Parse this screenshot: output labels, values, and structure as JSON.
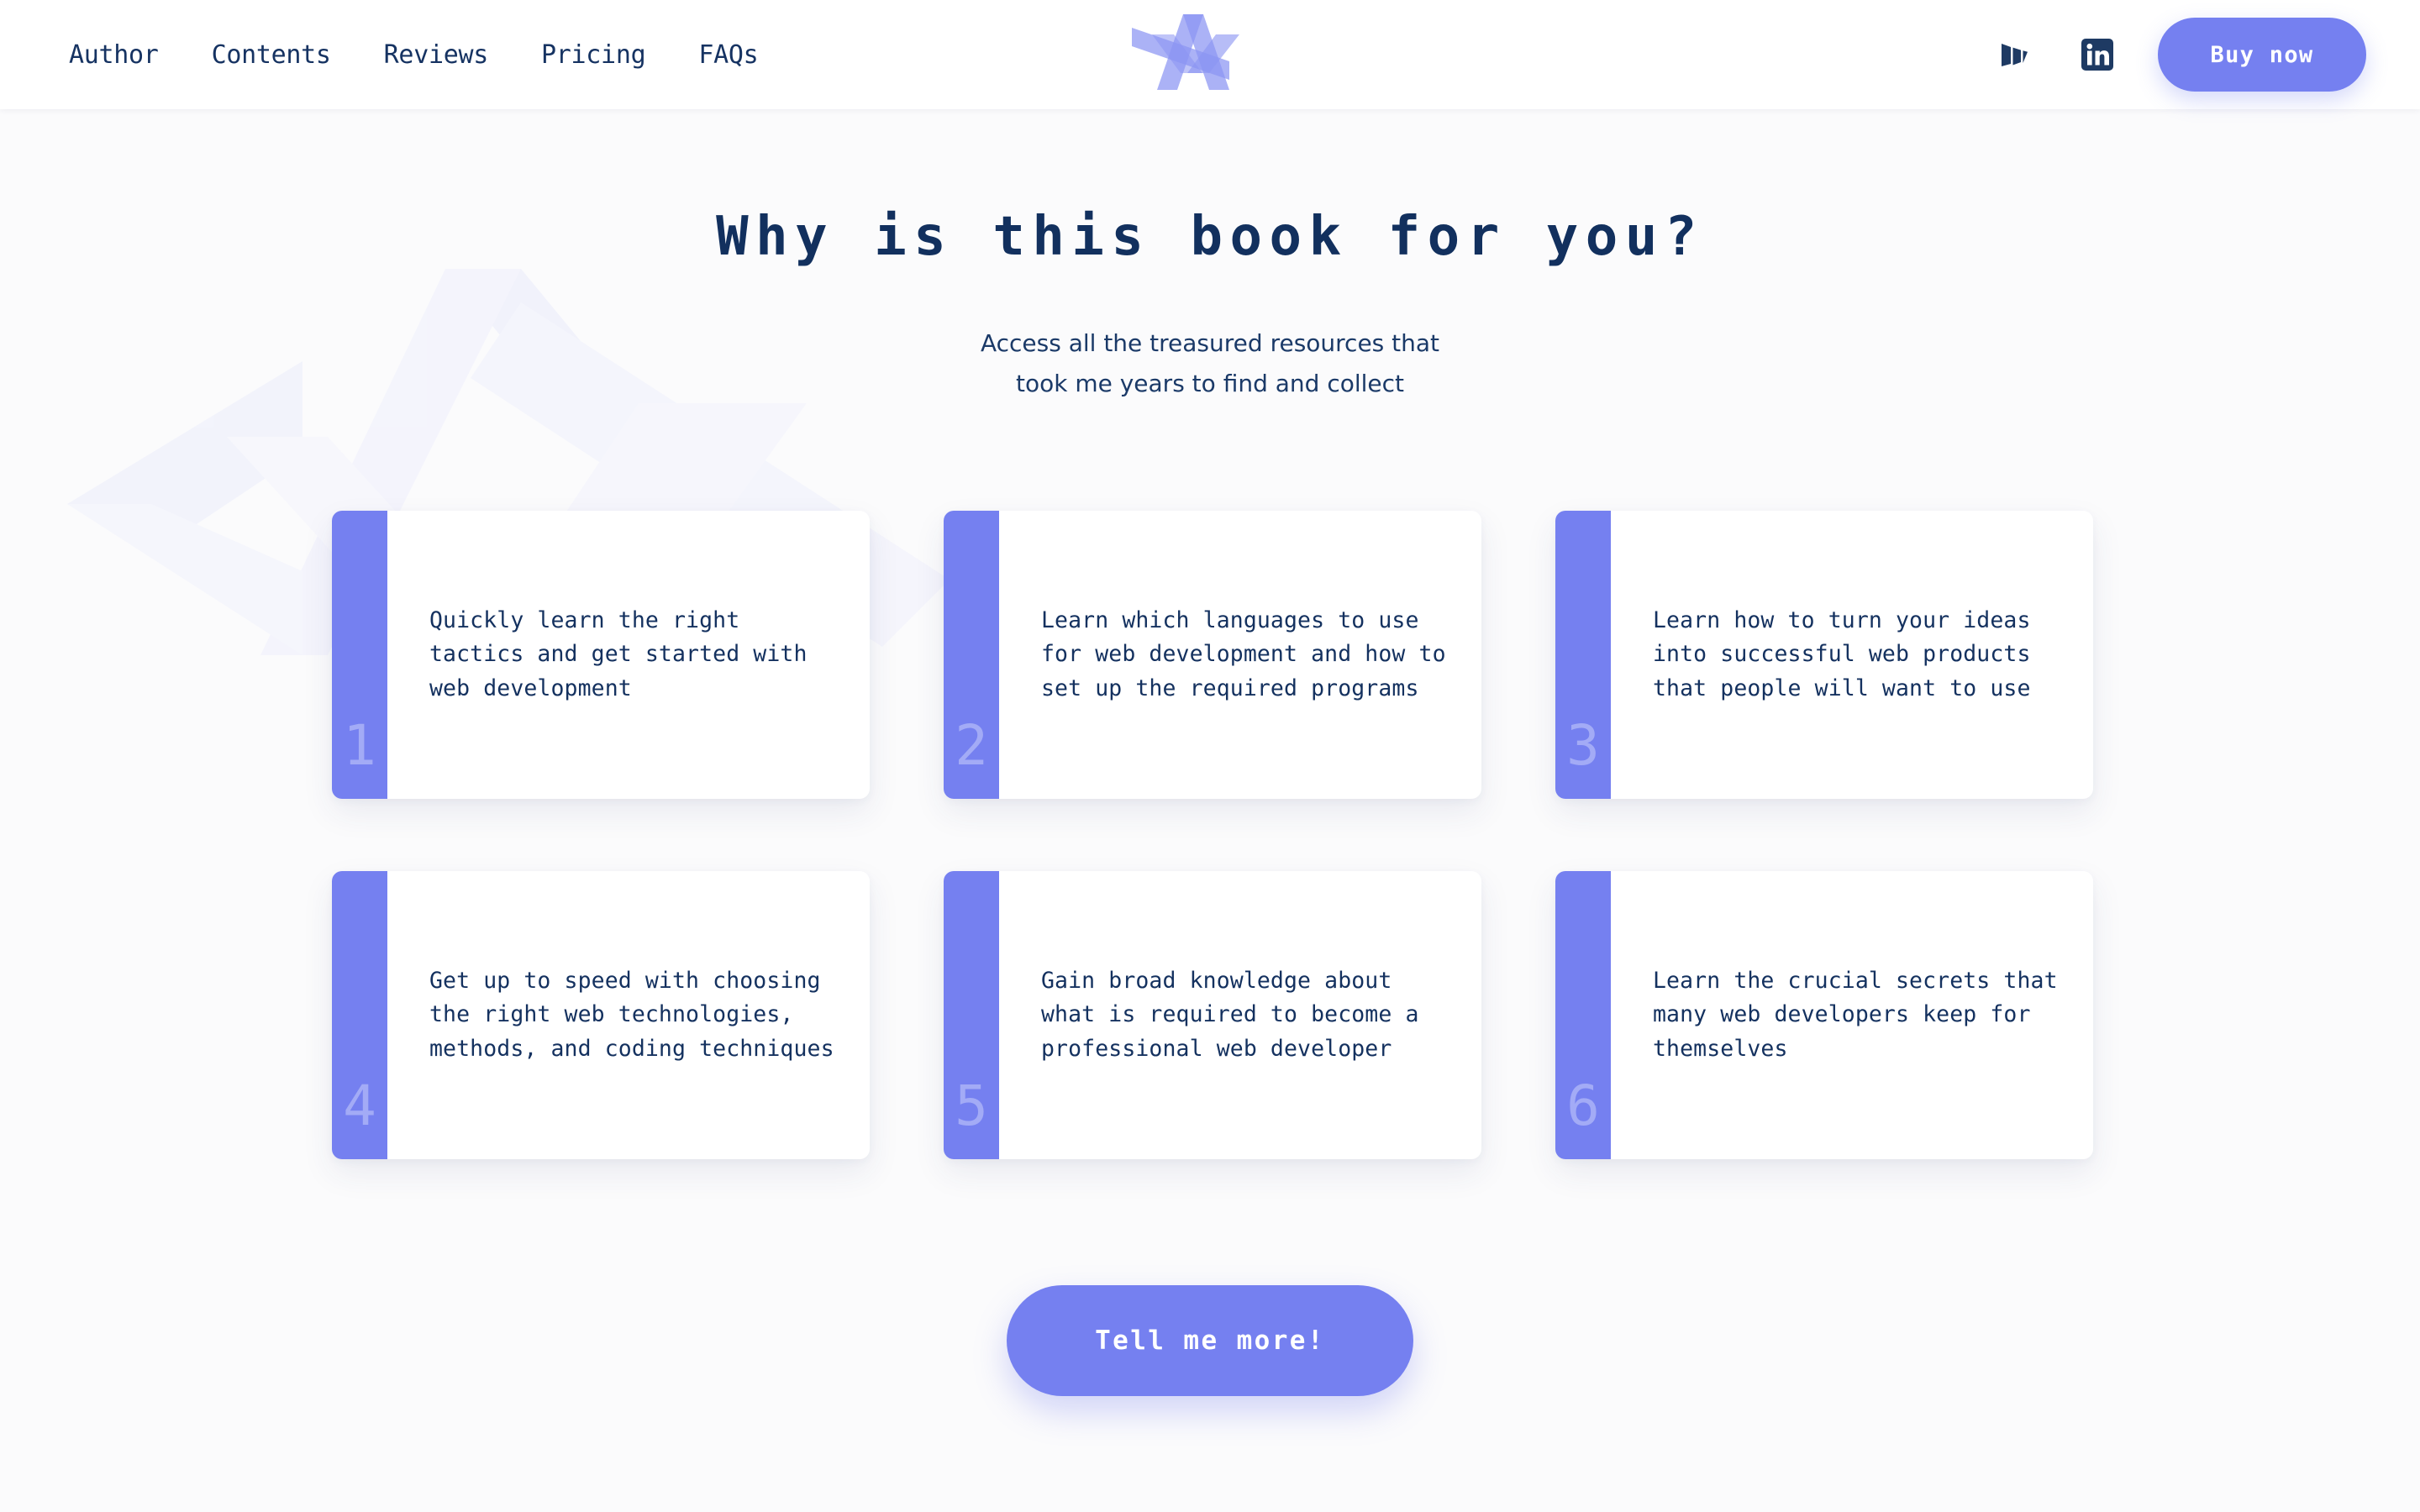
{
  "header": {
    "nav_items": [
      {
        "label": "Author"
      },
      {
        "label": "Contents"
      },
      {
        "label": "Reviews"
      },
      {
        "label": "Pricing"
      },
      {
        "label": "FAQs"
      }
    ],
    "logo_icon": "abstract-chevron-logo",
    "social": [
      {
        "icon": "medium-icon",
        "name": "Medium"
      },
      {
        "icon": "linkedin-icon",
        "name": "LinkedIn"
      }
    ],
    "buy_label": "Buy now"
  },
  "main": {
    "title": "Why is this book for you?",
    "subtitle": "Access all the treasured resources that took me years to find and collect",
    "cards": [
      {
        "number": "1",
        "text": "Quickly learn the right tactics and get started with web development"
      },
      {
        "number": "2",
        "text": "Learn which languages to use for web development and how to set up the required programs"
      },
      {
        "number": "3",
        "text": "Learn how to turn your ideas into successful web products that people will want to use"
      },
      {
        "number": "4",
        "text": "Get up to speed with choosing the right web technologies, methods, and coding techniques"
      },
      {
        "number": "5",
        "text": "Gain broad knowledge about what is required to become a professional web developer"
      },
      {
        "number": "6",
        "text": "Learn the crucial secrets that many web developers keep for themselves"
      }
    ],
    "cta_label": "Tell me more!"
  },
  "colors": {
    "accent": "#7580f0",
    "accent_light": "#a3abf6",
    "navy": "#13305f",
    "page_bg": "#fbfbfc",
    "card_bg": "#ffffff"
  }
}
